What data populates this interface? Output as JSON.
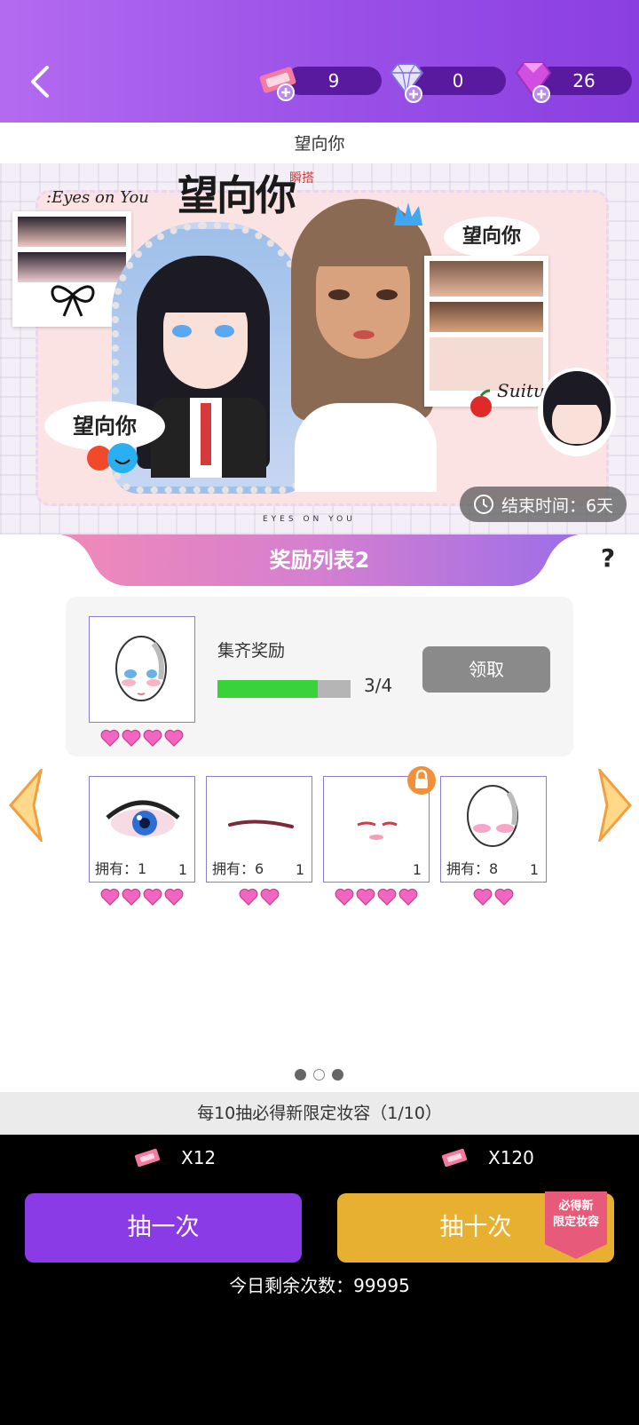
{
  "header": {
    "currencies": [
      {
        "name": "ticket",
        "value": "9"
      },
      {
        "name": "diamond",
        "value": "0"
      },
      {
        "name": "gem",
        "value": "26"
      }
    ]
  },
  "page_title": "望向你",
  "banner": {
    "logo_text": "望向你",
    "logo_sub": "瞬搭",
    "tagline": ":Eyes on You",
    "footer_text": "EYES ON YOU",
    "sticker_1": "望向你",
    "sticker_2": "望向你",
    "sticker_3": "Suitu",
    "timer": "结束时间：6天"
  },
  "reward_list": {
    "title": "奖励列表2",
    "help": "?",
    "collect_label": "集齐奖励",
    "progress_text": "3/4",
    "progress_fraction": 0.75,
    "claim_label": "领取",
    "main_hearts": 4,
    "items": [
      {
        "name": "eye",
        "own_text": "拥有：1",
        "qty": "1",
        "hearts": 4,
        "locked": false
      },
      {
        "name": "brow",
        "own_text": "拥有：6",
        "qty": "1",
        "hearts": 2,
        "locked": false
      },
      {
        "name": "lips",
        "own_text": "",
        "qty": "1",
        "hearts": 4,
        "locked": true
      },
      {
        "name": "blush",
        "own_text": "拥有：8",
        "qty": "1",
        "hearts": 2,
        "locked": false
      }
    ]
  },
  "pagination": {
    "count": 3,
    "active": 1
  },
  "guarantee_text": "每10抽必得新限定妆容（1/10）",
  "draw": {
    "single_cost": "X12",
    "ten_cost": "X120",
    "single_label": "抽一次",
    "ten_label": "抽十次",
    "ten_badge_line1": "必得新",
    "ten_badge_line2": "限定妆容",
    "remaining": "今日剩余次数：99995"
  },
  "colors": {
    "header": "#9b52e8",
    "single_button": "#8a3be6",
    "ten_button": "#e8b030",
    "badge": "#e85a7a",
    "heart": "#f066c0",
    "progress": "#3ad23a"
  }
}
